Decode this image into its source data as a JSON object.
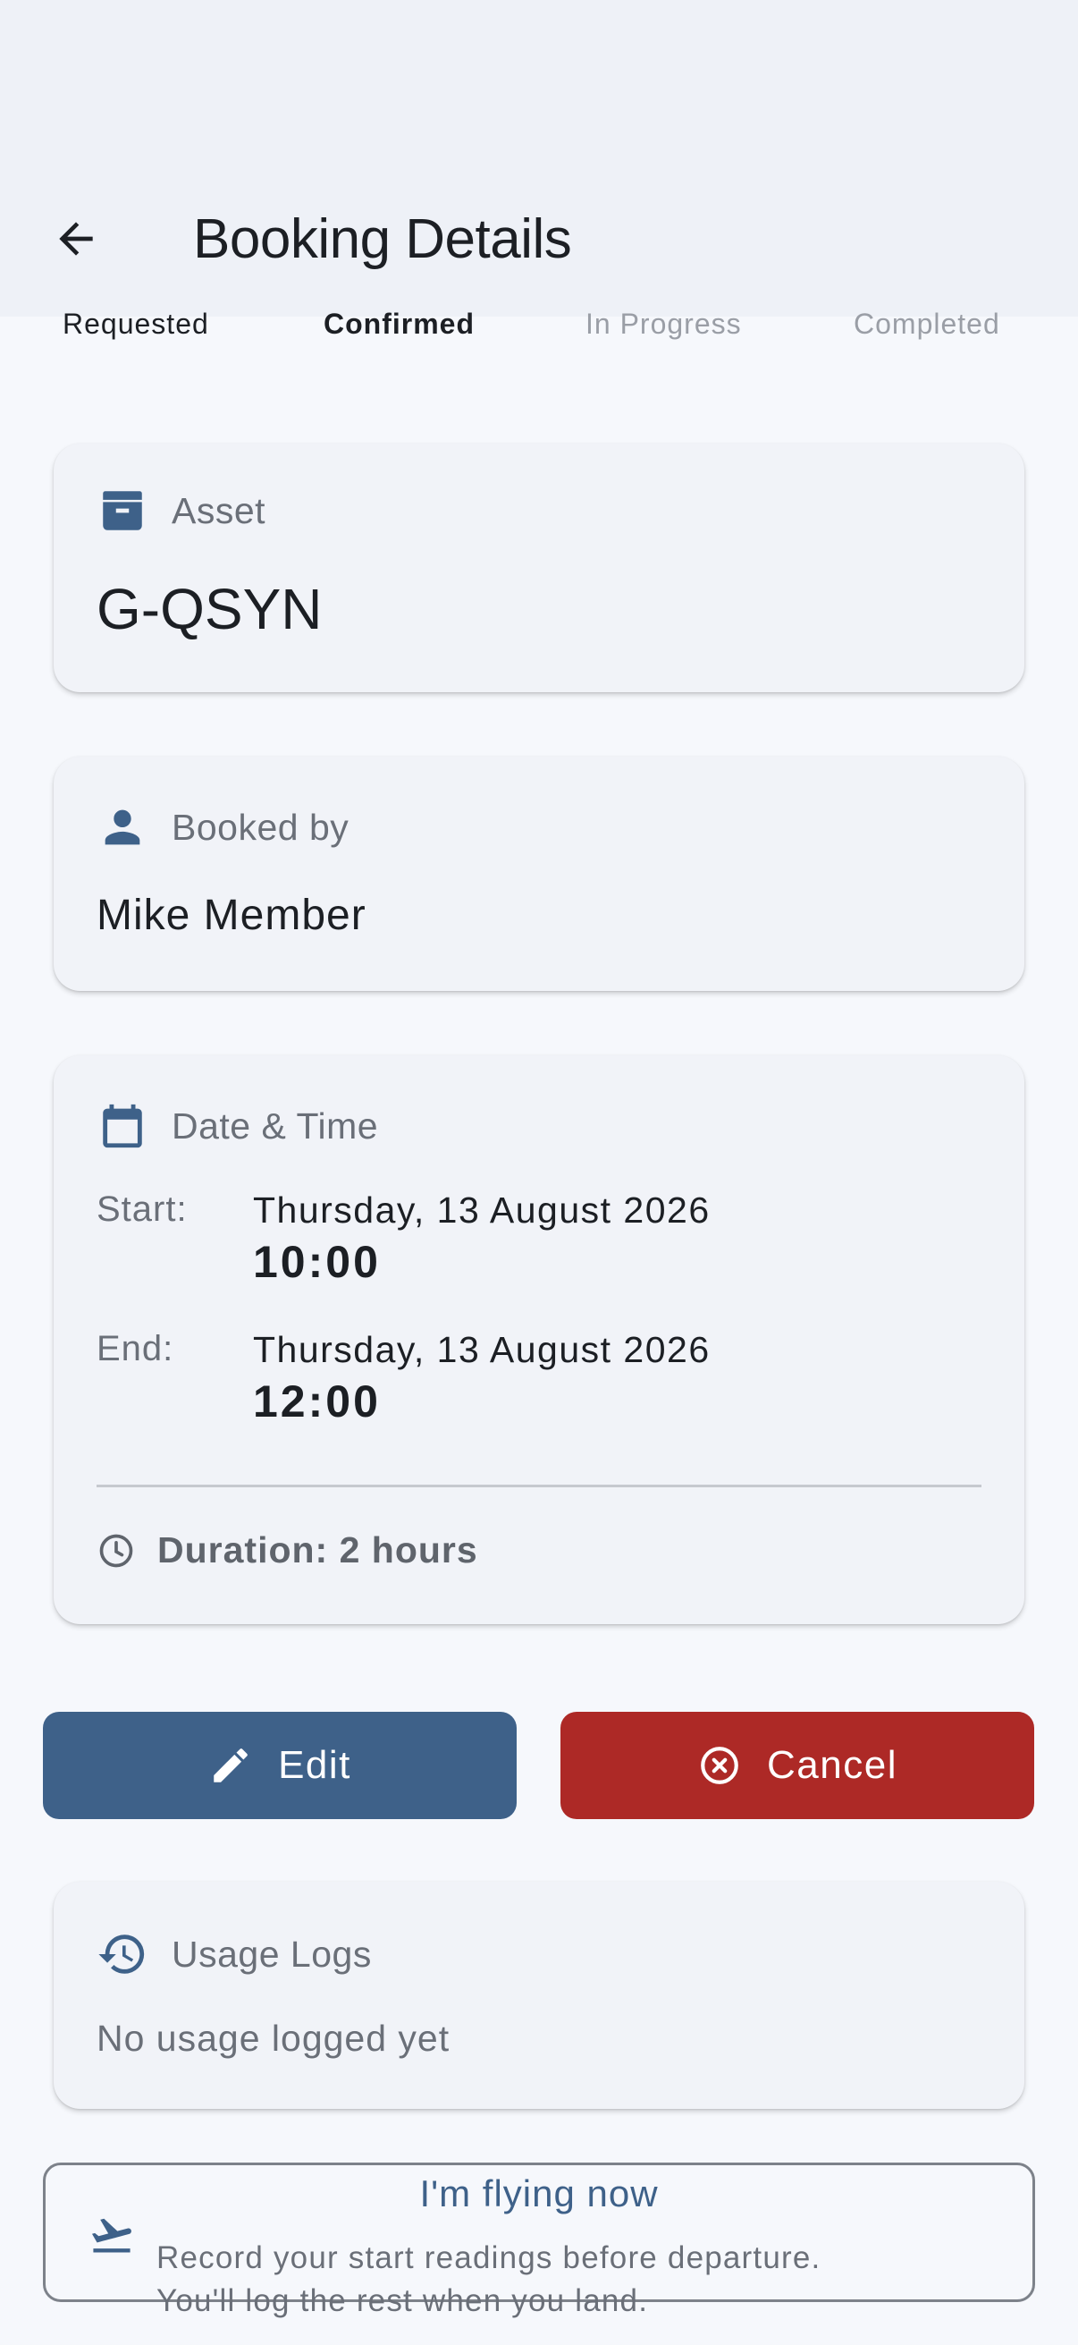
{
  "header": {
    "title": "Booking Details"
  },
  "steps": [
    "Requested",
    "Confirmed",
    "In Progress",
    "Completed"
  ],
  "asset": {
    "label": "Asset",
    "value": "G-QSYN"
  },
  "booked_by": {
    "label": "Booked by",
    "value": "Mike Member"
  },
  "date_time": {
    "label": "Date & Time",
    "start_label": "Start:",
    "start_date": "Thursday, 13 August 2026",
    "start_time": "10:00",
    "end_label": "End:",
    "end_date": "Thursday, 13 August 2026",
    "end_time": "12:00",
    "duration": "Duration: 2 hours"
  },
  "actions": {
    "edit_label": "Edit",
    "cancel_label": "Cancel"
  },
  "usage_logs": {
    "label": "Usage Logs",
    "empty": "No usage logged yet"
  },
  "flying": {
    "title": "I'm flying now",
    "line1": "Record your start readings before departure.",
    "line2": "You'll log the rest when you land."
  },
  "colors": {
    "primary": "#3e6189",
    "danger": "#ad2926",
    "background": "#f6f8fc",
    "card": "#f1f3f8"
  },
  "icons": {
    "back": "arrow-left-icon",
    "asset": "archive-box-icon",
    "booked_by": "person-icon",
    "date_time": "calendar-icon",
    "duration": "clock-icon",
    "edit": "pencil-icon",
    "cancel": "cancel-circle-icon",
    "usage": "history-icon",
    "flying": "airplane-takeoff-icon"
  }
}
